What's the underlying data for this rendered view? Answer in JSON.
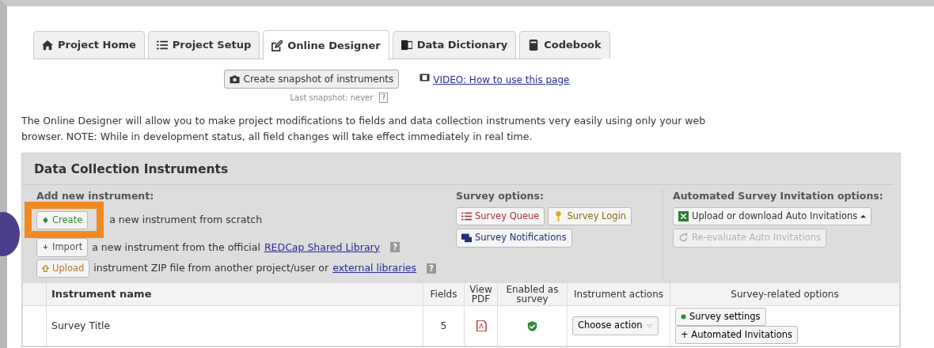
{
  "tabs": [
    {
      "label": "Project Home",
      "selected": false
    },
    {
      "label": "Project Setup",
      "selected": false
    },
    {
      "label": "Online Designer",
      "selected": true
    },
    {
      "label": "Data Dictionary",
      "selected": false
    },
    {
      "label": "Codebook",
      "selected": false
    }
  ],
  "snapshot": {
    "button": "Create snapshot of instruments",
    "note": "Last snapshot: never",
    "help": "?",
    "video_link": "VIDEO: How to use this page"
  },
  "intro": "The Online Designer will allow you to make project modifications to fields and data collection instruments very easily using only your web browser. NOTE: While in development status, all field changes will take effect immediately in real time.",
  "panel": {
    "title": "Data Collection Instruments",
    "add_new": {
      "heading": "Add new instrument:",
      "rows": [
        {
          "button": "Create",
          "kind": "create",
          "text": "a new instrument from scratch"
        },
        {
          "button": "Import",
          "kind": "import",
          "text": "a new instrument from the official",
          "link": "REDCap Shared Library",
          "help": "?"
        },
        {
          "button": "Upload",
          "kind": "upload",
          "text": "instrument ZIP file from another project/user or",
          "link": "external libraries",
          "help": "?"
        }
      ]
    },
    "survey_options": {
      "heading": "Survey options:",
      "buttons": [
        {
          "label": "Survey Queue",
          "kind": "queue"
        },
        {
          "label": "Survey Login",
          "kind": "login"
        },
        {
          "label": "Survey Notifications",
          "kind": "notify"
        }
      ]
    },
    "asi_options": {
      "heading": "Automated Survey Invitation options:",
      "buttons": [
        {
          "label": "Upload or download Auto Invitations",
          "kind": "excel",
          "disabled": false
        },
        {
          "label": "Re-evaluate Auto Invitations",
          "kind": "refresh",
          "disabled": true
        }
      ]
    }
  },
  "table": {
    "columns": [
      "Instrument name",
      "Fields",
      "View PDF",
      "Enabled as survey",
      "Instrument actions",
      "Survey-related options"
    ],
    "rows": [
      {
        "name": "Survey Title",
        "fields": "5",
        "enabled_as_survey": true,
        "action": "Choose action",
        "survey_buttons": [
          "Survey settings",
          "+ Automated Invitations"
        ]
      }
    ]
  }
}
